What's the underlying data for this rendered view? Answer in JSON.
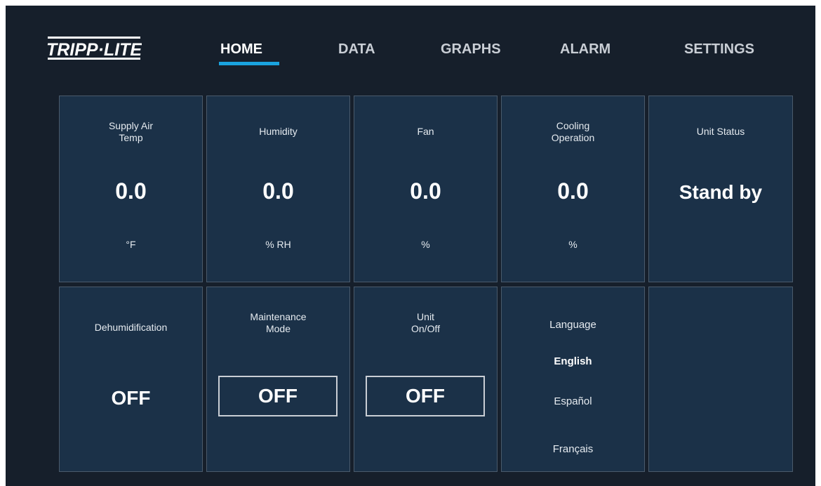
{
  "brand": {
    "logo_text": "TRIPP·LITE"
  },
  "nav": {
    "items": [
      {
        "label": "HOME",
        "active": true
      },
      {
        "label": "DATA",
        "active": false
      },
      {
        "label": "GRAPHS",
        "active": false
      },
      {
        "label": "ALARM",
        "active": false
      },
      {
        "label": "SETTINGS",
        "active": false
      }
    ],
    "accent_color": "#1aa3df"
  },
  "tiles": {
    "supply_air_temp": {
      "label": "Supply Air\nTemp",
      "value": "0.0",
      "unit": "°F"
    },
    "humidity": {
      "label": "Humidity",
      "value": "0.0",
      "unit": "% RH"
    },
    "fan": {
      "label": "Fan",
      "value": "0.0",
      "unit": "%"
    },
    "cooling_operation": {
      "label": "Cooling\nOperation",
      "value": "0.0",
      "unit": "%"
    },
    "unit_status": {
      "label": "Unit Status",
      "value": "Stand by"
    },
    "dehumidification": {
      "label": "Dehumidification",
      "value": "OFF"
    },
    "maintenance_mode": {
      "label": "Maintenance\nMode",
      "button_label": "OFF"
    },
    "unit_on_off": {
      "label": "Unit\nOn/Off",
      "button_label": "OFF"
    },
    "language": {
      "label": "Language",
      "options": [
        "English",
        "Español",
        "Français"
      ],
      "selected": "English"
    }
  },
  "colors": {
    "background": "#161f2b",
    "tile": "#1b3148",
    "tile_border": "#4a5a6b"
  }
}
